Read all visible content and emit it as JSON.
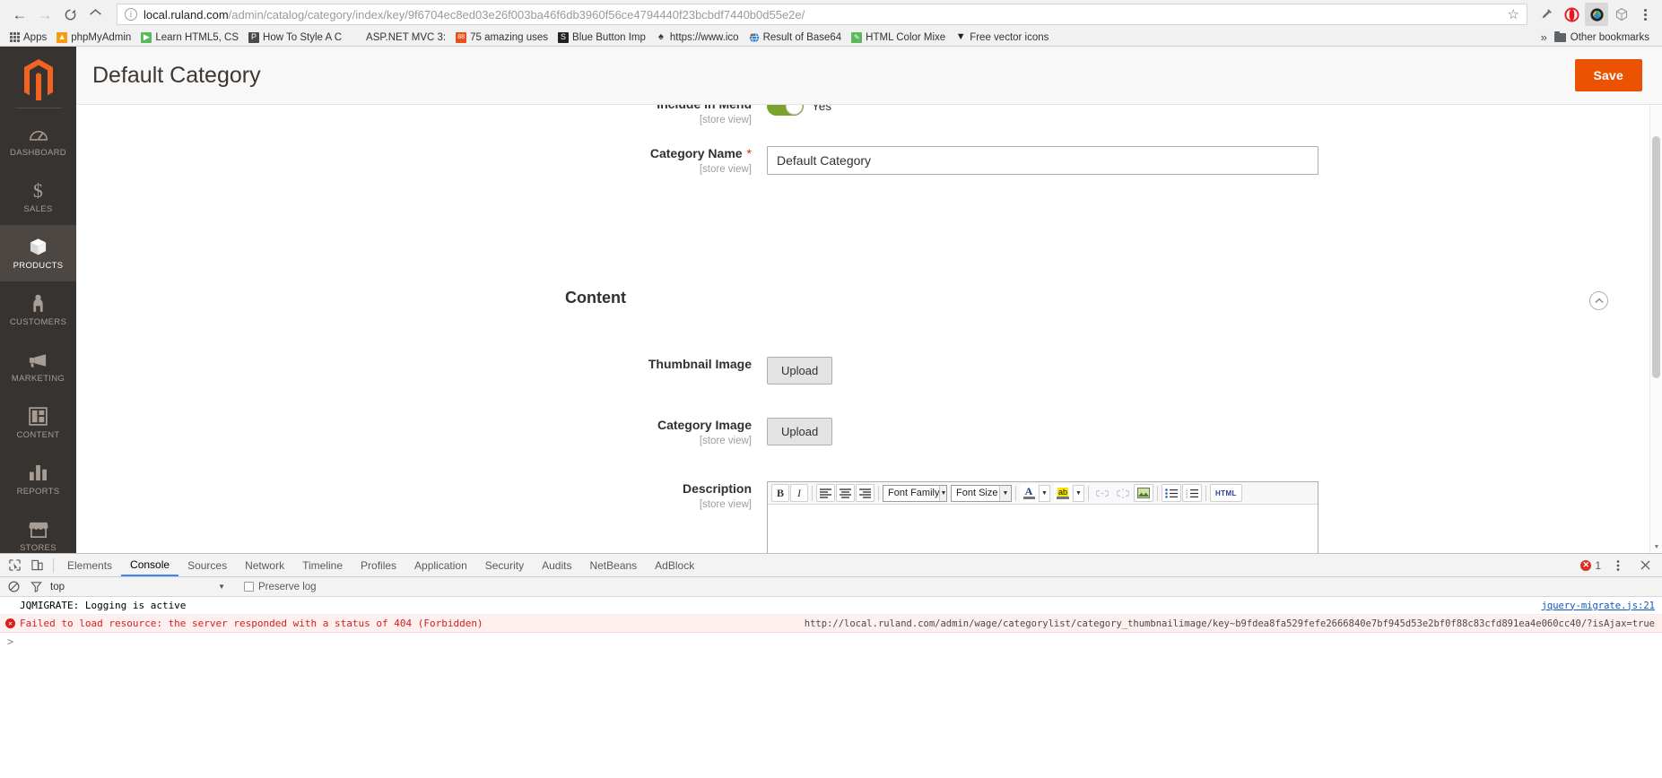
{
  "browser": {
    "nav": {
      "back": "←",
      "forward": "→",
      "reload": "C",
      "home": "⌂"
    },
    "url_host": "local.ruland.com",
    "url_path": "/admin/catalog/category/index/key/9f6704ec8ed03e26f003ba46f6db3960f56ce4794440f23bcbdf7440b0d55e2e/",
    "star": "☆",
    "extensions": [
      {
        "name": "eyedropper-icon",
        "glyph": "🖋"
      },
      {
        "name": "opera-extension-icon",
        "glyph": "◑"
      },
      {
        "name": "colorzilla-icon",
        "glyph": "◉"
      },
      {
        "name": "box-extension-icon",
        "glyph": "⬡"
      }
    ],
    "bookmarks": [
      {
        "label": "Apps",
        "icon": "apps-grid-icon",
        "color": "#5f6368",
        "glyph": ""
      },
      {
        "label": "phpMyAdmin",
        "icon": "phpmyadmin-icon",
        "color": "#f89c0e",
        "glyph": "▲"
      },
      {
        "label": "Learn HTML5, CS",
        "icon": "youtube-icon",
        "color": "#5cb85c",
        "glyph": "▶"
      },
      {
        "label": "How To Style A C",
        "icon": "page-icon",
        "color": "#4a4a4a",
        "glyph": "P"
      },
      {
        "label": "ASP.NET MVC 3: ",
        "icon": "microsoft-icon",
        "color": "#f25022",
        "glyph": "⊞"
      },
      {
        "label": "75 amazing uses",
        "icon": "orange-icon",
        "color": "#e8501a",
        "glyph": "88"
      },
      {
        "label": "Blue Button Imp",
        "icon": "stackoverflow-icon",
        "color": "#222222",
        "glyph": "S"
      },
      {
        "label": "https://www.ico",
        "icon": "generic-site-icon",
        "color": "#333333",
        "glyph": "♠"
      },
      {
        "label": "Result of Base64",
        "icon": "globe-icon",
        "color": "#2b7fd0",
        "glyph": "🌏"
      },
      {
        "label": "HTML Color Mixe",
        "icon": "color-icon",
        "color": "#5cb85c",
        "glyph": "▧"
      },
      {
        "label": "Free vector icons",
        "icon": "flaticon-icon",
        "color": "#222222",
        "glyph": "▼"
      }
    ],
    "overflow_chevron": "»",
    "other_bookmarks": "Other bookmarks"
  },
  "admin": {
    "sidebar": [
      {
        "label": "DASHBOARD",
        "icon": "dashboard-gauge-icon",
        "active": false
      },
      {
        "label": "SALES",
        "icon": "dollar-sign-icon",
        "active": false
      },
      {
        "label": "PRODUCTS",
        "icon": "products-box-icon",
        "active": true
      },
      {
        "label": "CUSTOMERS",
        "icon": "customers-person-icon",
        "active": false
      },
      {
        "label": "MARKETING",
        "icon": "marketing-megaphone-icon",
        "active": false
      },
      {
        "label": "CONTENT",
        "icon": "content-layout-icon",
        "active": false
      },
      {
        "label": "REPORTS",
        "icon": "reports-bar-chart-icon",
        "active": false
      },
      {
        "label": "STORES",
        "icon": "stores-shop-icon",
        "active": false
      }
    ],
    "page_title": "Default Category",
    "save_label": "Save",
    "fields": {
      "include_in_menu": {
        "label": "Include in Menu",
        "scope": "[store view]",
        "toggle_value": "Yes"
      },
      "category_name": {
        "label": "Category Name",
        "required": "*",
        "scope": "[store view]",
        "value": "Default Category"
      },
      "thumbnail_image": {
        "label": "Thumbnail Image",
        "scope": "",
        "button": "Upload"
      },
      "category_image": {
        "label": "Category Image",
        "scope": "[store view]",
        "button": "Upload"
      },
      "description": {
        "label": "Description",
        "scope": "[store view]",
        "value": ""
      }
    },
    "content_section": {
      "title": "Content",
      "collapse_icon": "chevron-up-icon"
    },
    "editor_toolbar": {
      "bold": "B",
      "italic": "I",
      "align_left": "align-left-icon",
      "align_center": "align-center-icon",
      "align_right": "align-right-icon",
      "font_family": "Font Family",
      "font_size": "Font Size",
      "text_color": "A",
      "highlight_color": "ab",
      "link": "link-icon",
      "unlink": "unlink-icon",
      "image": "image-icon",
      "bullet_list": "bullet-list-icon",
      "numbered_list": "numbered-list-icon",
      "html": "HTML"
    }
  },
  "devtools": {
    "tabs": [
      "Elements",
      "Console",
      "Sources",
      "Network",
      "Timeline",
      "Profiles",
      "Application",
      "Security",
      "Audits",
      "NetBeans",
      "AdBlock"
    ],
    "selected_tab": "Console",
    "error_count": "1",
    "filter": {
      "context": "top",
      "preserve_log": "Preserve log",
      "clear_icon": "clear-console-icon",
      "filter_icon": "filter-funnel-icon"
    },
    "messages": [
      {
        "type": "log",
        "text": "JQMIGRATE: Logging is active",
        "source": "jquery-migrate.js:21"
      },
      {
        "type": "error",
        "text": "Failed to load resource: the server responded with a status of 404 (Forbidden)",
        "source": "http://local.ruland.com/admin/wage/categorylist/category_thumbnailimage/key~b9fdea8fa529fefe2666840e7bf945d53e2bf0f88c83cfd891ea4e060cc40/?isAjax=true"
      }
    ],
    "prompt": ">"
  }
}
